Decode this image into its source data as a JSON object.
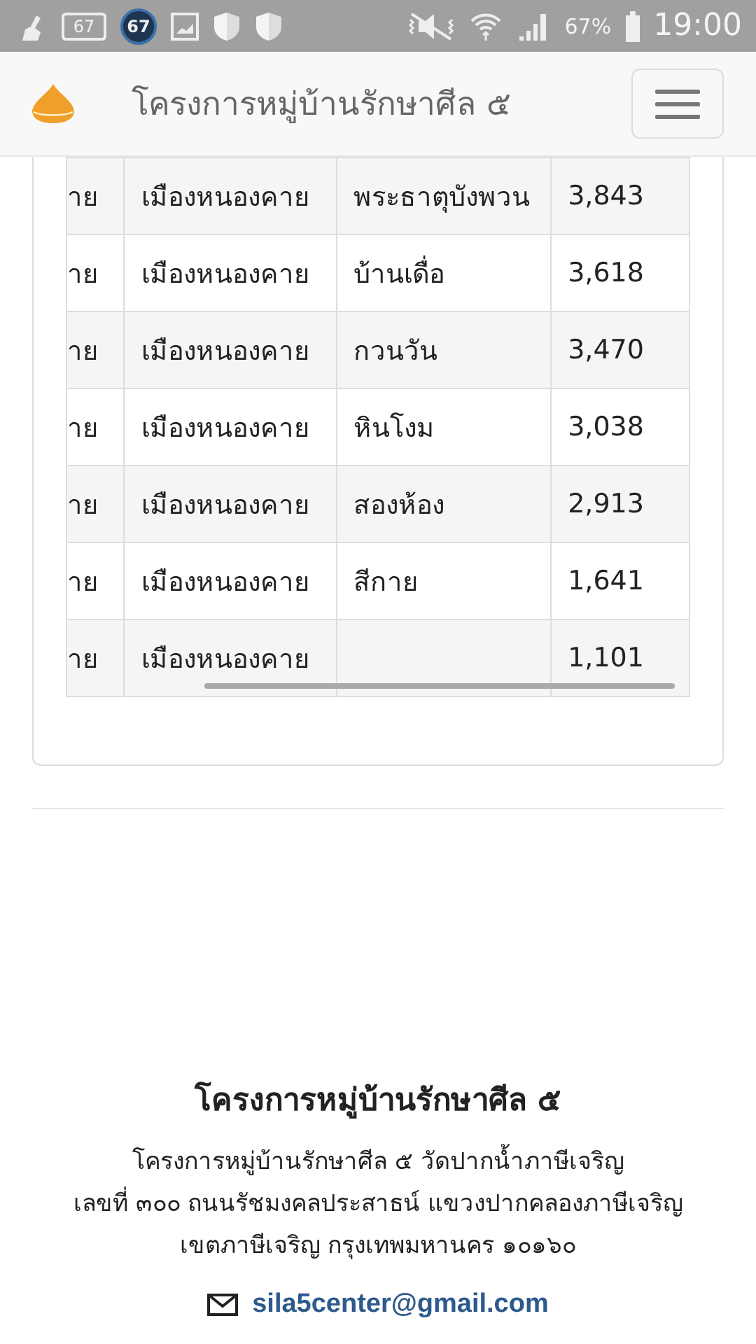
{
  "status_bar": {
    "badge_texts": [
      "67",
      "67"
    ],
    "battery": "67%",
    "time": "19:00"
  },
  "navbar": {
    "title": "โครงการหมู่บ้านรักษาศีล ๕"
  },
  "table": {
    "rows": [
      {
        "column_1": "าย",
        "column_2": "เมืองหนองคาย",
        "column_3": "พระธาตุบังพวน",
        "column_4": "3,843"
      },
      {
        "column_1": "าย",
        "column_2": "เมืองหนองคาย",
        "column_3": "บ้านเดื่อ",
        "column_4": "3,618"
      },
      {
        "column_1": "าย",
        "column_2": "เมืองหนองคาย",
        "column_3": "กวนวัน",
        "column_4": "3,470"
      },
      {
        "column_1": "าย",
        "column_2": "เมืองหนองคาย",
        "column_3": "หินโงม",
        "column_4": "3,038"
      },
      {
        "column_1": "าย",
        "column_2": "เมืองหนองคาย",
        "column_3": "สองห้อง",
        "column_4": "2,913"
      },
      {
        "column_1": "าย",
        "column_2": "เมืองหนองคาย",
        "column_3": "สีกาย",
        "column_4": "1,641"
      },
      {
        "column_1": "าย",
        "column_2": "เมืองหนองคาย",
        "column_4": "1,101"
      }
    ]
  },
  "footer": {
    "title": "โครงการหมู่บ้านรักษาศีล ๕",
    "lines": [
      "โครงการหมู่บ้านรักษาศีล ๕ วัดปากน้ำภาษีเจริญ",
      "เลขที่ ๓๐๐ ถนนรัชมงคลประสาธน์ แขวงปากคลองภาษีเจริญ",
      "เขตภาษีเจริญ กรุงเทพมหานคร ๑๐๑๖๐"
    ],
    "email": "sila5center@gmail.com"
  }
}
